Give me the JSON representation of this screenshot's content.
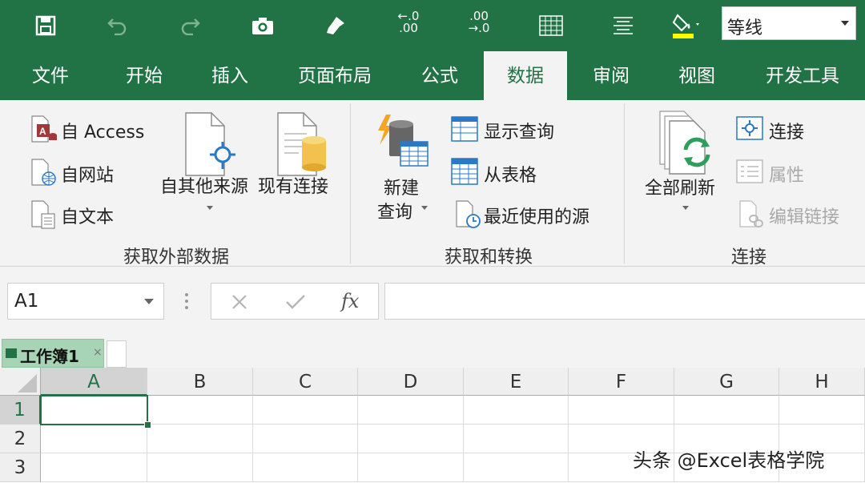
{
  "colors": {
    "brand": "#217346",
    "ribbon_bg": "#f3f3f3",
    "tab_text": "#ffffff"
  },
  "qat": {
    "icons": [
      "save-icon",
      "undo-icon",
      "redo-icon",
      "camera-icon",
      "format-painter-icon",
      "increase-decimal-icon",
      "decrease-decimal-icon",
      "borders-icon",
      "align-center-icon",
      "fill-color-icon"
    ],
    "increase_decimal_top": "←.0",
    "increase_decimal_bottom": ".00",
    "decrease_decimal_top": ".00",
    "decrease_decimal_bottom": "→.0",
    "font_name": "等线"
  },
  "tabs": [
    {
      "label": "文件"
    },
    {
      "label": "开始"
    },
    {
      "label": "插入"
    },
    {
      "label": "页面布局"
    },
    {
      "label": "公式"
    },
    {
      "label": "数据",
      "active": true
    },
    {
      "label": "审阅"
    },
    {
      "label": "视图"
    },
    {
      "label": "开发工具"
    }
  ],
  "ribbon": {
    "get_external": {
      "label": "获取外部数据",
      "from_access": "自 Access",
      "from_web": "自网站",
      "from_text": "自文本",
      "from_other": "自其他来源",
      "existing": "现有连接"
    },
    "get_transform": {
      "label": "获取和转换",
      "new_query_1": "新建",
      "new_query_2": "查询",
      "show_queries": "显示查询",
      "from_table": "从表格",
      "recent_sources": "最近使用的源"
    },
    "connections": {
      "label": "连接",
      "refresh_all": "全部刷新",
      "connections": "连接",
      "properties": "属性",
      "edit_links": "编辑链接"
    }
  },
  "formula_bar": {
    "name_box": "A1",
    "formula": ""
  },
  "workbook_tab": {
    "label": "工作簿1",
    "close": "×"
  },
  "grid": {
    "columns": [
      "A",
      "B",
      "C",
      "D",
      "E",
      "F",
      "G",
      "H"
    ],
    "rows": [
      "1",
      "2",
      "3"
    ],
    "active_cell": "A1"
  },
  "watermark": "头条 @Excel表格学院"
}
